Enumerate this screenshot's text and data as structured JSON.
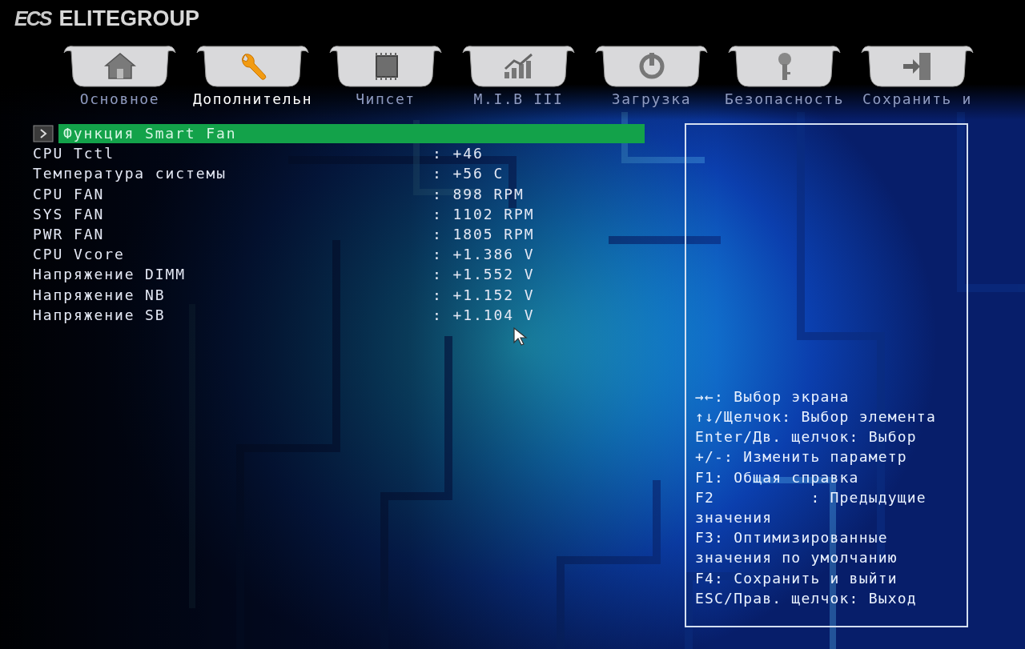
{
  "logo": {
    "mark": "ECS",
    "brand": "ELITEGROUP"
  },
  "tabs": [
    {
      "kind": "home",
      "label": "Основное",
      "selected": false
    },
    {
      "kind": "wrench",
      "label": "Дополнительн",
      "selected": true
    },
    {
      "kind": "chip",
      "label": "Чипсет",
      "selected": false
    },
    {
      "kind": "chart",
      "label": "M.I.B III",
      "selected": false
    },
    {
      "kind": "power",
      "label": "Загрузка",
      "selected": false
    },
    {
      "kind": "key",
      "label": "Безопасность",
      "selected": false
    },
    {
      "kind": "exit",
      "label": "Сохранить и",
      "selected": false
    }
  ],
  "items": [
    {
      "kind": "submenu",
      "label": "Функция Smart Fan",
      "selected": true
    },
    {
      "kind": "reading",
      "label": "CPU Tctl",
      "value": ": +46"
    },
    {
      "kind": "reading",
      "label": "Температура системы",
      "value": ": +56 C"
    },
    {
      "kind": "reading",
      "label": "CPU FAN",
      "value": ": 898 RPM"
    },
    {
      "kind": "reading",
      "label": "SYS FAN",
      "value": ": 1102 RPM"
    },
    {
      "kind": "reading",
      "label": "PWR FAN",
      "value": ": 1805 RPM"
    },
    {
      "kind": "reading",
      "label": "CPU Vcore",
      "value": ": +1.386 V"
    },
    {
      "kind": "reading",
      "label": "Напряжение DIMM",
      "value": ": +1.552 V"
    },
    {
      "kind": "reading",
      "label": "Напряжение NB",
      "value": ": +1.152 V"
    },
    {
      "kind": "reading",
      "label": "Напряжение SB",
      "value": ": +1.104 V"
    }
  ],
  "help": [
    "→←: Выбор экрана",
    "↑↓/Щелчок: Выбор элемента",
    "Enter/Дв. щелчок: Выбор",
    "+/-: Изменить параметр",
    "F1: Общая справка",
    "F2          : Предыдущие",
    "значения",
    "F3: Оптимизированные",
    "значения по умолчанию",
    "F4: Сохранить и выйти",
    "ESC/Прав. щелчок: Выход"
  ]
}
